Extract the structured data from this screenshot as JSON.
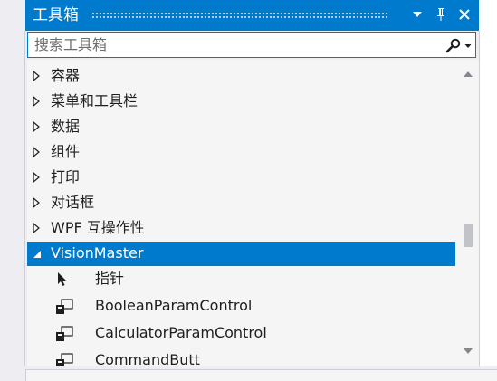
{
  "panel": {
    "title": "工具箱"
  },
  "search": {
    "placeholder": "搜索工具箱"
  },
  "categories": [
    {
      "label": "容器"
    },
    {
      "label": "菜单和工具栏"
    },
    {
      "label": "数据"
    },
    {
      "label": "组件"
    },
    {
      "label": "打印"
    },
    {
      "label": "对话框"
    },
    {
      "label": "WPF 互操作性"
    },
    {
      "label": "VisionMaster"
    }
  ],
  "items": [
    {
      "label": "指针",
      "icon": "pointer-icon"
    },
    {
      "label": "BooleanParamControl",
      "icon": "control-icon"
    },
    {
      "label": "CalculatorParamControl",
      "icon": "control-icon"
    },
    {
      "label": "CommandButt",
      "icon": "control-icon"
    }
  ],
  "colors": {
    "accent": "#007acc",
    "list_bg": "#f5f5f5"
  }
}
